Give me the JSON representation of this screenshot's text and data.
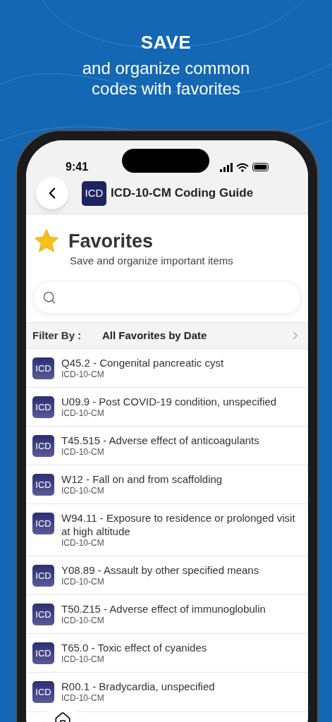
{
  "headline": {
    "title": "SAVE",
    "subtitle": "and organize common codes with favorites"
  },
  "status_bar": {
    "time": "9:41"
  },
  "nav": {
    "app_badge": "ICD",
    "title": "ICD-10-CM Coding Guide"
  },
  "page": {
    "title": "Favorites",
    "subtitle": "Save and organize important items"
  },
  "filter": {
    "label": "Filter By :",
    "value": "All Favorites by Date"
  },
  "items": [
    {
      "badge": "ICD",
      "title": "Q45.2 - Congenital pancreatic cyst",
      "subtitle": "ICD-10-CM"
    },
    {
      "badge": "ICD",
      "title": "U09.9 - Post COVID-19 condition, unspecified",
      "subtitle": "ICD-10-CM"
    },
    {
      "badge": "ICD",
      "title": "T45.515 - Adverse effect of anticoagulants",
      "subtitle": "ICD-10-CM"
    },
    {
      "badge": "ICD",
      "title": "W12 - Fall on and from scaffolding",
      "subtitle": "ICD-10-CM"
    },
    {
      "badge": "ICD",
      "title": "W94.11 - Exposure to residence or prolonged visit at high altitude",
      "subtitle": "ICD-10-CM"
    },
    {
      "badge": "ICD",
      "title": "Y08.89 - Assault by other specified means",
      "subtitle": "ICD-10-CM"
    },
    {
      "badge": "ICD",
      "title": "T50.Z15 - Adverse effect of immunoglobulin",
      "subtitle": "ICD-10-CM"
    },
    {
      "badge": "ICD",
      "title": "T65.0 - Toxic effect of cyanides",
      "subtitle": "ICD-10-CM"
    },
    {
      "badge": "ICD",
      "title": "R00.1 - Bradycardia, unspecified",
      "subtitle": "ICD-10-CM"
    }
  ]
}
